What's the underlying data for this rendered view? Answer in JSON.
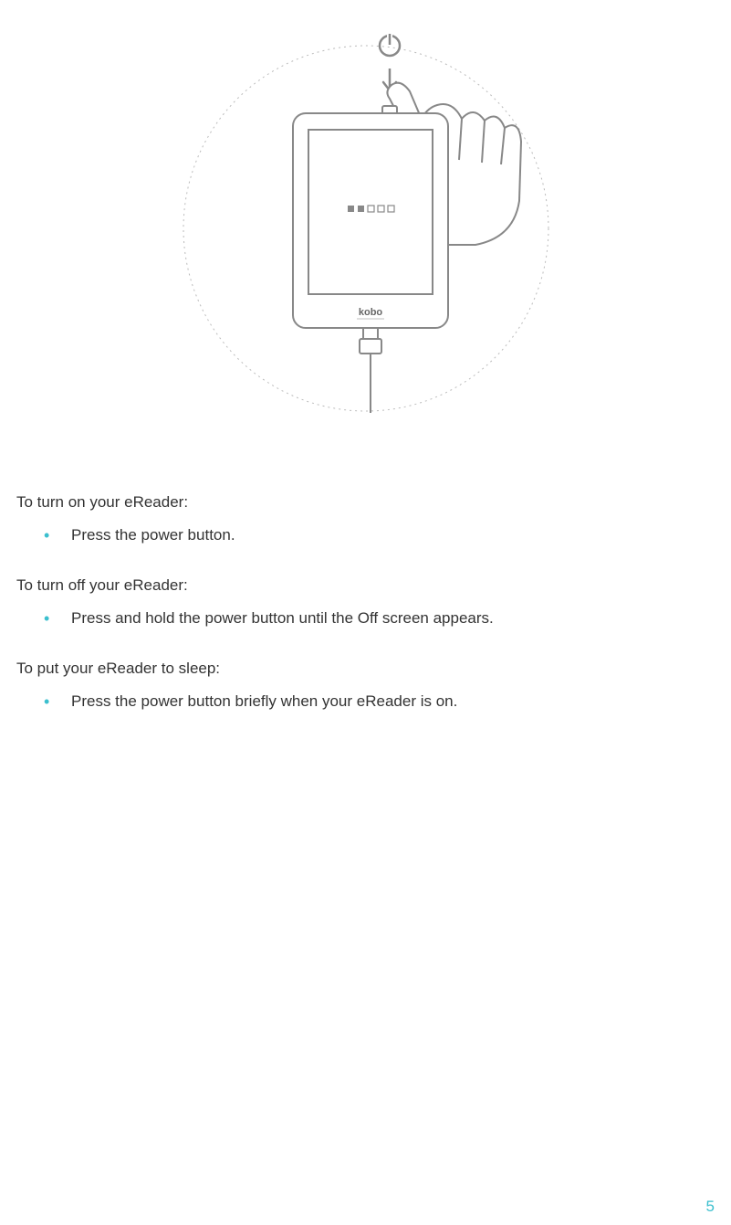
{
  "illustration": {
    "brand_label": "kobo",
    "power_icon_name": "power-icon"
  },
  "sections": [
    {
      "heading": "To turn on your eReader:",
      "bullets": [
        "Press the power button."
      ]
    },
    {
      "heading": "To turn off your eReader:",
      "bullets": [
        "Press and hold the power button until the Off screen appears."
      ]
    },
    {
      "heading": "To put your eReader to sleep:",
      "bullets": [
        "Press the power button briefly when your eReader is on."
      ]
    }
  ],
  "page_number": "5"
}
